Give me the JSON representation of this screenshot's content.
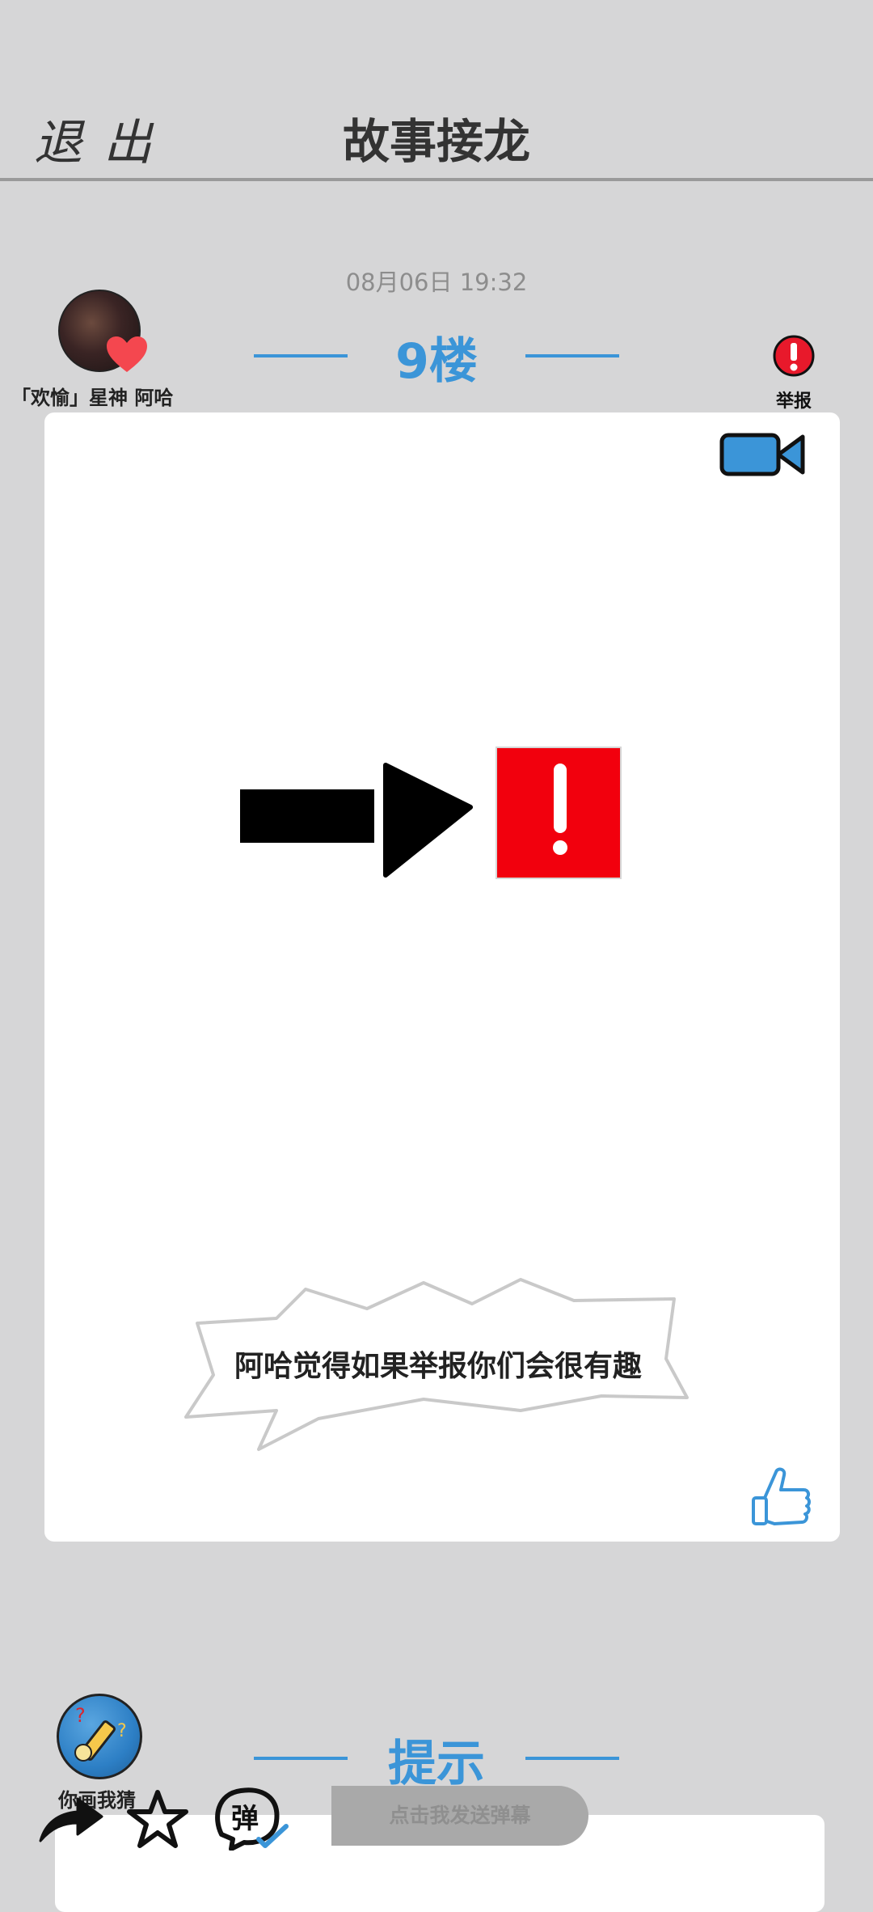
{
  "header": {
    "exit_label": "退出",
    "title": "故事接龙"
  },
  "post": {
    "timestamp": "08月06日  19:32",
    "author": "「欢愉」星神  阿哈",
    "floor": "9楼",
    "report_label": "举报",
    "caption": "阿哈觉得如果举报你们会很有趣"
  },
  "hint": {
    "title": "提示",
    "author": "你画我猜"
  },
  "bottom_bar": {
    "danmaku_placeholder": "点击我发送弹幕"
  },
  "colors": {
    "accent": "#3b95d8",
    "report_red": "#e8192b",
    "background": "#d6d6d7"
  },
  "icons": [
    "heart-icon",
    "report-icon",
    "video-icon",
    "thumbs-up-icon",
    "share-icon",
    "star-icon",
    "danmaku-icon"
  ]
}
